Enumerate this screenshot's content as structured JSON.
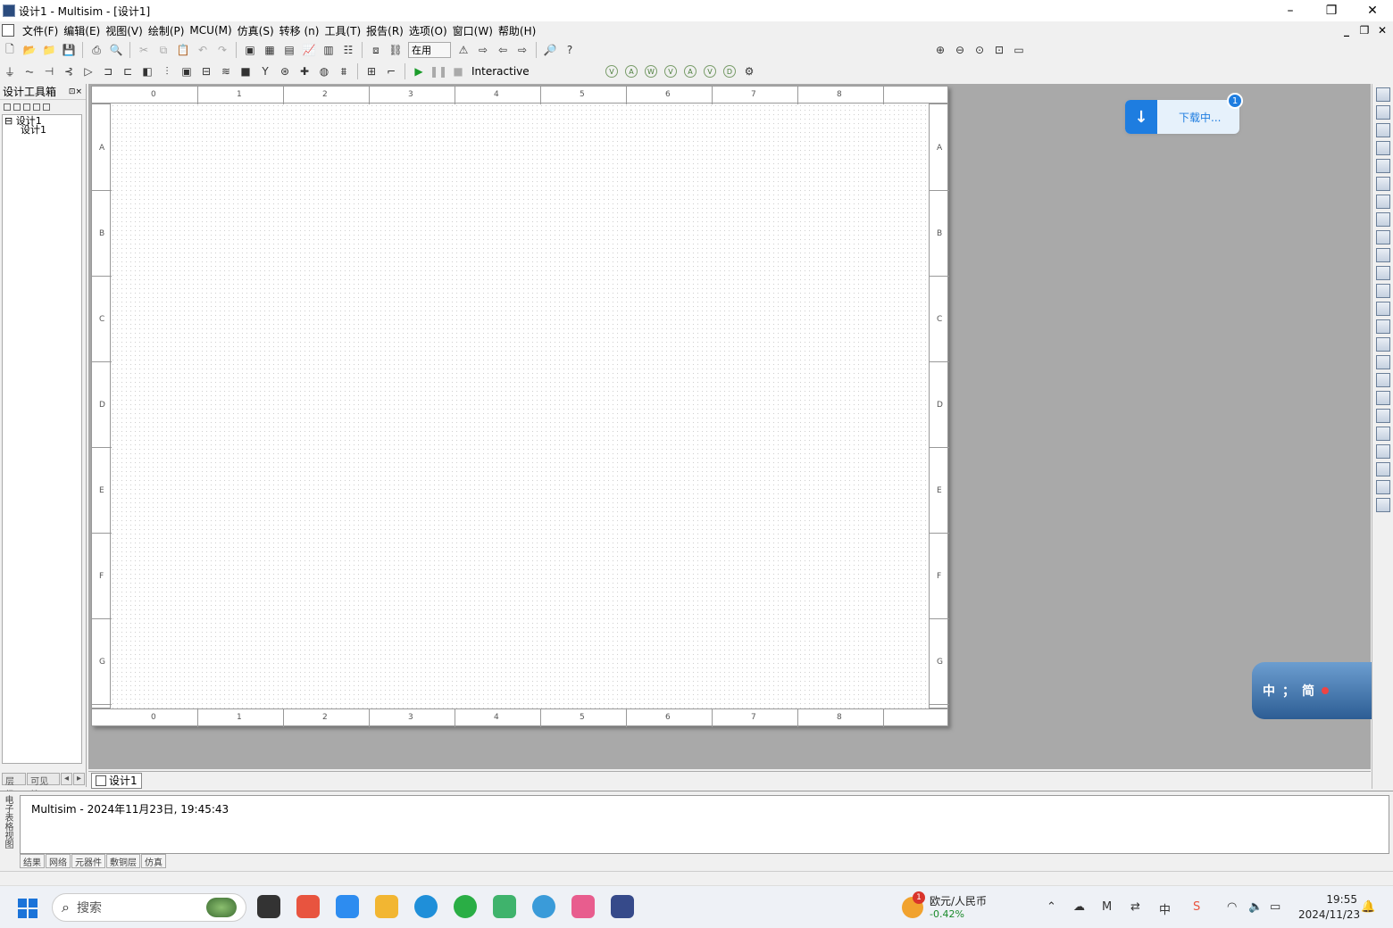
{
  "window": {
    "title": "设计1 - Multisim - [设计1]",
    "minimize_glyph": "–",
    "restore_glyph": "❐",
    "close_glyph": "✕"
  },
  "menubar": {
    "items": [
      "文件(F)",
      "编辑(E)",
      "视图(V)",
      "绘制(P)",
      "MCU(M)",
      "仿真(S)",
      "转移 (n)",
      "工具(T)",
      "报告(R)",
      "选项(O)",
      "窗口(W)",
      "帮助(H)"
    ]
  },
  "toolbar": {
    "inuse_label": "在用",
    "sim_mode_label": "Interactive"
  },
  "design_toolbox": {
    "title": "设计工具箱",
    "tree_root": "设计1",
    "tree_child": "设计1",
    "tab_hierarchy": "层级",
    "tab_visibility": "可见性"
  },
  "sheet": {
    "col_labels": [
      "0",
      "1",
      "2",
      "3",
      "4",
      "5",
      "6",
      "7",
      "8"
    ],
    "row_labels": [
      "A",
      "B",
      "C",
      "D",
      "E",
      "F",
      "G"
    ]
  },
  "download_toast": {
    "text": "下载中...",
    "badge": "1"
  },
  "ime": {
    "mode_cn": "中",
    "punct": "；",
    "script": "简"
  },
  "doc_tab": {
    "label": "设计1"
  },
  "output": {
    "side_label": "电子表格视图",
    "log_line": "Multisim  -  2024年11月23日, 19:45:43",
    "tabs": [
      "结果",
      "网络",
      "元器件",
      "敷铜层",
      "仿真"
    ]
  },
  "taskbar": {
    "search_placeholder": "搜索",
    "stock_name": "欧元/人民币",
    "stock_change": "-0.42%",
    "stock_badge": "1",
    "time": "19:55",
    "date": "2024/11/23",
    "ime_indicator": "中"
  },
  "colors": {
    "accent_blue": "#1e7de0",
    "workspace_gray": "#a9a9a9",
    "run_green": "#1b9c2b"
  }
}
